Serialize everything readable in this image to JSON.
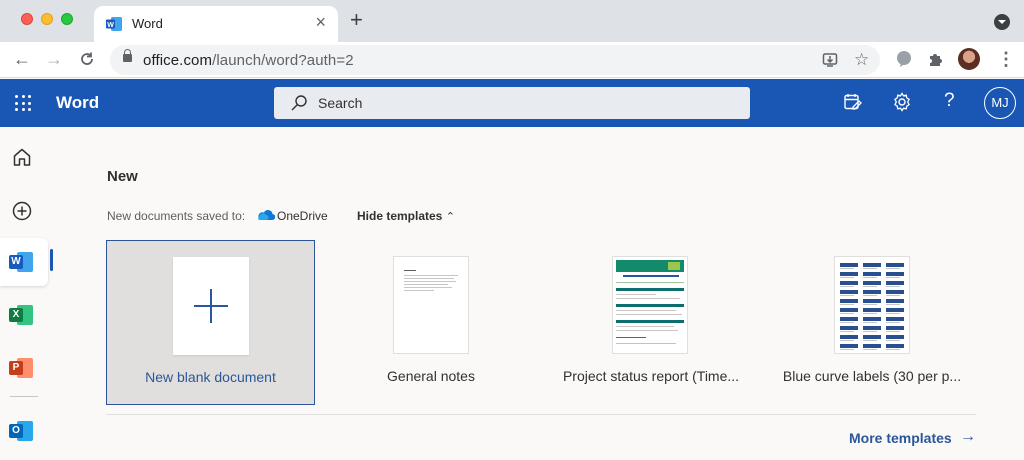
{
  "browser": {
    "tab_title": "Word",
    "url_host": "office.com",
    "url_path": "/launch/word?auth=2"
  },
  "appbar": {
    "app_name": "Word",
    "search_label": "Search",
    "avatar_initials": "MJ",
    "color": "#1a56b4"
  },
  "rail": {
    "icons": [
      "home-icon",
      "add-circle-icon",
      "word-icon",
      "excel-icon",
      "powerpoint-icon",
      "outlook-icon"
    ],
    "tiles": [
      {
        "letter": "W",
        "color": "#185abd",
        "back": "#41a5ee"
      },
      {
        "letter": "X",
        "color": "#107c41",
        "back": "#33c481"
      },
      {
        "letter": "P",
        "color": "#c43e1c",
        "back": "#ff8f6b"
      },
      {
        "letter": "O",
        "color": "#0364b8",
        "back": "#28a8ea"
      }
    ]
  },
  "content": {
    "section_title": "New",
    "save_label": "New documents saved to:",
    "save_location": "OneDrive",
    "hide_templates": "Hide templates",
    "templates": [
      {
        "label": "New blank document"
      },
      {
        "label": "General notes"
      },
      {
        "label": "Project status report (Time..."
      },
      {
        "label": "Blue curve labels (30 per p..."
      }
    ],
    "more_templates": "More templates"
  }
}
